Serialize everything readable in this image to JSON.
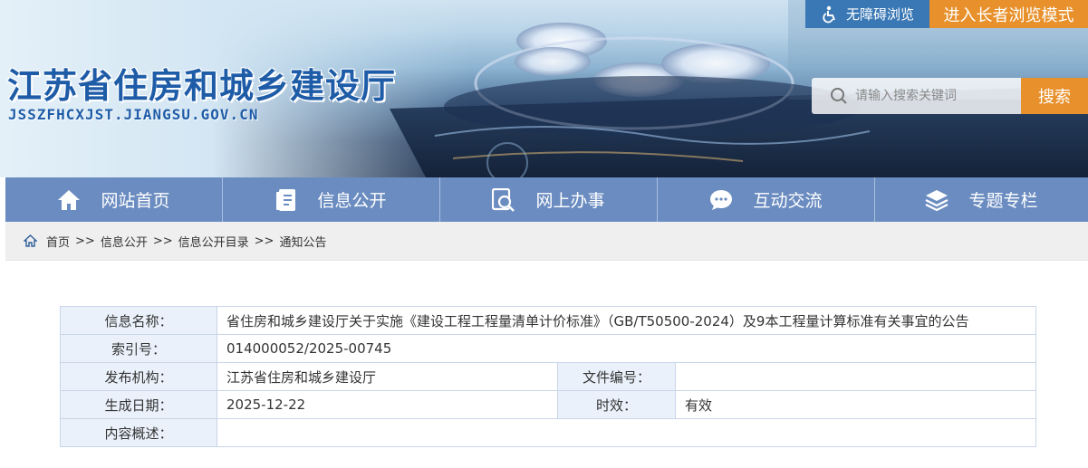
{
  "header": {
    "site_title": "江苏省住房和城乡建设厅",
    "site_domain": "JSSZFHCXJST.JIANGSU.GOV.CN",
    "accessibility_label": "无障碍浏览",
    "elder_mode_label": "进入长者浏览模式",
    "search": {
      "placeholder": "请输入搜索关键词",
      "button_label": "搜索"
    }
  },
  "nav": {
    "items": [
      {
        "label": "网站首页",
        "icon": "home-icon"
      },
      {
        "label": "信息公开",
        "icon": "document-icon"
      },
      {
        "label": "网上办事",
        "icon": "online-service-icon"
      },
      {
        "label": "互动交流",
        "icon": "chat-icon"
      },
      {
        "label": "专题专栏",
        "icon": "layers-icon"
      }
    ]
  },
  "breadcrumb": {
    "icon": "home-icon",
    "items": [
      "首页",
      "信息公开",
      "信息公开目录",
      "通知公告"
    ],
    "separator": ">>"
  },
  "meta": {
    "name_label": "信息名称：",
    "name_value": "省住房和城乡建设厅关于实施《建设工程工程量清单计价标准》（GB/T50500-2024）及9本工程量计算标准有关事宜的公告",
    "index_label": "索引号：",
    "index_value": "014000052/2025-00745",
    "publisher_label": "发布机构：",
    "publisher_value": "江苏省住房和城乡建设厅",
    "doc_no_label": "文件编号：",
    "doc_no_value": "",
    "date_label": "生成日期：",
    "date_value": "2025-12-22",
    "validity_label": "时效：",
    "validity_value": "有效",
    "summary_label": "内容概述：",
    "summary_value": ""
  },
  "colors": {
    "nav_bg": "#6b8cc0",
    "accent_orange": "#e8912c",
    "title_blue": "#1f5ca8",
    "a11y_blue": "#3a78b5"
  }
}
